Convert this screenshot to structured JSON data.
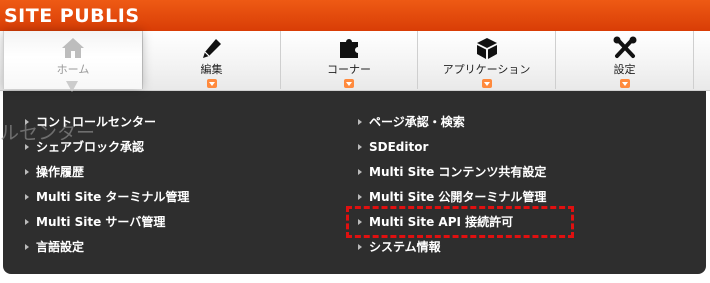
{
  "app": {
    "logo_text": "SITE PUBLIS"
  },
  "nav": {
    "items": [
      {
        "label": "ホーム",
        "icon": "home-icon",
        "active": true
      },
      {
        "label": "編集",
        "icon": "pencil-icon",
        "active": false
      },
      {
        "label": "コーナー",
        "icon": "puzzle-icon",
        "active": false
      },
      {
        "label": "アプリケーション",
        "icon": "cube-icon",
        "active": false
      },
      {
        "label": "設定",
        "icon": "tools-icon",
        "active": false
      }
    ]
  },
  "menu": {
    "background_text": "ルセンター",
    "left": [
      "コントロールセンター",
      "シェアブロック承認",
      "操作履歴",
      "Multi Site ターミナル管理",
      "Multi Site サーバ管理",
      "言語設定"
    ],
    "right": [
      "ページ承認・検索",
      "SDEditor",
      "Multi Site コンテンツ共有設定",
      "Multi Site 公開ターミナル管理",
      "Multi Site API 接続許可",
      "システム情報"
    ],
    "highlighted_item": "Multi Site API 接続許可"
  },
  "colors": {
    "header": "#e84d0e",
    "panel": "#2e2e2e",
    "arrow": "#ff8a3d",
    "highlight": "#e01010"
  }
}
